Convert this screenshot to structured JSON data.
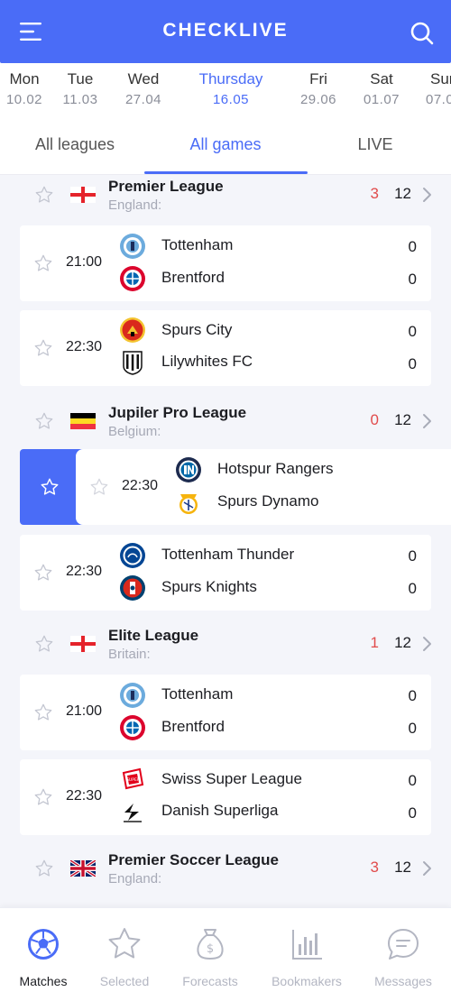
{
  "app": {
    "title": "CHECKLIVE"
  },
  "dates": [
    {
      "day": "Mon",
      "date": "10.02"
    },
    {
      "day": "Tue",
      "date": "11.03"
    },
    {
      "day": "Wed",
      "date": "27.04"
    },
    {
      "day": "Thursday",
      "date": "16.05",
      "active": true
    },
    {
      "day": "Fri",
      "date": "29.06"
    },
    {
      "day": "Sat",
      "date": "01.07"
    },
    {
      "day": "Sun",
      "date": "07.0"
    }
  ],
  "tabs": [
    {
      "label": "All leagues"
    },
    {
      "label": "All games",
      "active": true
    },
    {
      "label": "LIVE"
    }
  ],
  "leagues": [
    {
      "name": "Premier League",
      "country": "England:",
      "live": "3",
      "total": "12",
      "flag": "england"
    },
    {
      "name": "Jupiler Pro League",
      "country": "Belgium:",
      "live": "0",
      "total": "12",
      "flag": "belgium"
    },
    {
      "name": "Elite League",
      "country": "Britain:",
      "live": "1",
      "total": "12",
      "flag": "england"
    },
    {
      "name": "Premier Soccer League",
      "country": "England:",
      "live": "3",
      "total": "12",
      "flag": "uk"
    }
  ],
  "matches": [
    {
      "time": "21:00",
      "home": "Tottenham",
      "away": "Brentford",
      "home_score": "0",
      "away_score": "0",
      "home_logo": "mancity-crest-icon",
      "away_logo": "bayern-crest-icon"
    },
    {
      "time": "22:30",
      "home": "Spurs City",
      "away": "Lilywhites FC",
      "home_score": "0",
      "away_score": "0",
      "home_logo": "manutd-crest-icon",
      "away_logo": "juventus-crest-icon"
    },
    {
      "time": "22:30",
      "home": "Hotspur Rangers",
      "away": "Spurs Dynamo",
      "home_score": "",
      "away_score": "",
      "home_logo": "inter-crest-icon",
      "away_logo": "realmadrid-crest-icon"
    },
    {
      "time": "22:30",
      "home": "Tottenham Thunder",
      "away": "Spurs Knights",
      "home_score": "0",
      "away_score": "0",
      "home_logo": "chelsea-crest-icon",
      "away_logo": "psg-crest-icon"
    },
    {
      "time": "21:00",
      "home": "Tottenham",
      "away": "Brentford",
      "home_score": "0",
      "away_score": "0",
      "home_logo": "mancity-crest-icon",
      "away_logo": "bayern-crest-icon"
    },
    {
      "time": "22:30",
      "home": "Swiss Super League",
      "away": "Danish Superliga",
      "home_score": "0",
      "away_score": "0",
      "home_logo": "swiss-league-icon",
      "away_logo": "superliga-icon"
    }
  ],
  "bottom_nav": [
    {
      "label": "Matches",
      "icon": "soccer-ball-icon",
      "active": true
    },
    {
      "label": "Selected",
      "icon": "star-icon"
    },
    {
      "label": "Forecasts",
      "icon": "money-bag-icon"
    },
    {
      "label": "Bookmakers",
      "icon": "bar-chart-icon"
    },
    {
      "label": "Messages",
      "icon": "chat-bubble-icon"
    }
  ],
  "colors": {
    "accent": "#4a6cf7",
    "live": "#e14b4b",
    "muted": "#a6a9b6"
  }
}
